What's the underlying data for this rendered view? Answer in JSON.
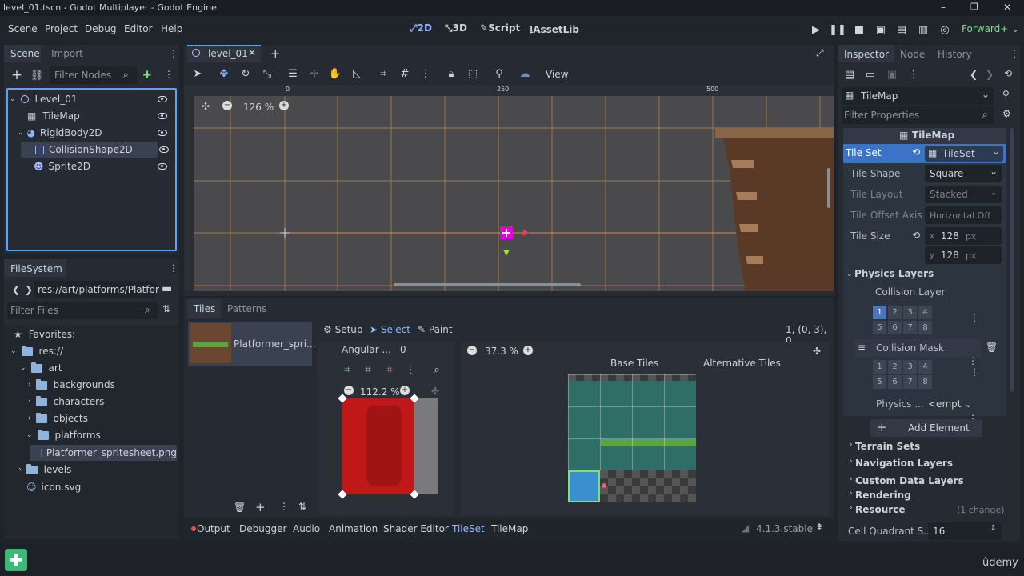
{
  "window": {
    "title": "level_01.tscn - Godot Multiplayer - Godot Engine",
    "min": "–",
    "restore": "❐",
    "close": "✕"
  },
  "menu": [
    "Scene",
    "Project",
    "Debug",
    "Editor",
    "Help"
  ],
  "workspaces": [
    "2D",
    "3D",
    "Script",
    "AssetLib"
  ],
  "renderer": "Forward+",
  "scene_dock": {
    "tabs": [
      "Scene",
      "Import"
    ],
    "filter_placeholder": "Filter Nodes",
    "nodes": [
      {
        "name": "Level_01"
      },
      {
        "name": "TileMap"
      },
      {
        "name": "RigidBody2D"
      },
      {
        "name": "CollisionShape2D"
      },
      {
        "name": "Sprite2D"
      }
    ]
  },
  "filesystem": {
    "tab": "FileSystem",
    "path": "res://art/platforms/Platfor",
    "filter_placeholder": "Filter Files",
    "items": [
      "Favorites:",
      "res://",
      "art",
      "backgrounds",
      "characters",
      "objects",
      "platforms",
      "Platformer_spritesheet.png",
      "levels",
      "icon.svg"
    ]
  },
  "editor": {
    "tab": "level_01",
    "zoom": "126 %",
    "view_label": "View",
    "ruler": [
      "0",
      "250",
      "500"
    ]
  },
  "tileset_panel": {
    "tabs": [
      "Tiles",
      "Patterns"
    ],
    "source_name": "Platformer_spri...",
    "modes": [
      "Setup",
      "Select",
      "Paint"
    ],
    "coords": "1, (0, 3), 0",
    "angular_label": "Angular ...",
    "angular_value": "0",
    "preview_zoom": "112.2 %",
    "atlas_zoom": "37.3 %",
    "base_tiles": "Base Tiles",
    "alt_tiles": "Alternative Tiles"
  },
  "bottom_tabs": [
    "Output",
    "Debugger",
    "Audio",
    "Animation",
    "Shader Editor",
    "TileSet",
    "TileMap"
  ],
  "version": "4.1.3.stable",
  "inspector": {
    "tabs": [
      "Inspector",
      "Node",
      "History"
    ],
    "object": "TileMap",
    "filter_placeholder": "Filter Properties",
    "section": "TileMap",
    "tile_set_label": "Tile Set",
    "tile_set_value": "TileSet",
    "props": [
      {
        "label": "Tile Shape",
        "value": "Square"
      },
      {
        "label": "Tile Layout",
        "value": "Stacked"
      },
      {
        "label": "Tile Offset Axis",
        "value": "Horizontal Off"
      }
    ],
    "tile_size_label": "Tile Size",
    "tile_size": {
      "x": "128",
      "y": "128",
      "unit": "px"
    },
    "physics_layers": "Physics Layers",
    "collision_layer": "Collision Layer",
    "collision_mask": "Collision Mask",
    "layer_nums": [
      "1",
      "2",
      "3",
      "4",
      "5",
      "6",
      "7",
      "8"
    ],
    "physics_label": "Physics ...",
    "physics_value": "<empt",
    "add_element": "Add Element",
    "groups": [
      "Terrain Sets",
      "Navigation Layers",
      "Custom Data Layers",
      "Rendering",
      "Resource"
    ],
    "resource_note": "(1 change)",
    "cell_quadrant_label": "Cell Quadrant S...",
    "cell_quadrant_value": "16"
  },
  "taskbar": {
    "brand": "ûdemy"
  }
}
